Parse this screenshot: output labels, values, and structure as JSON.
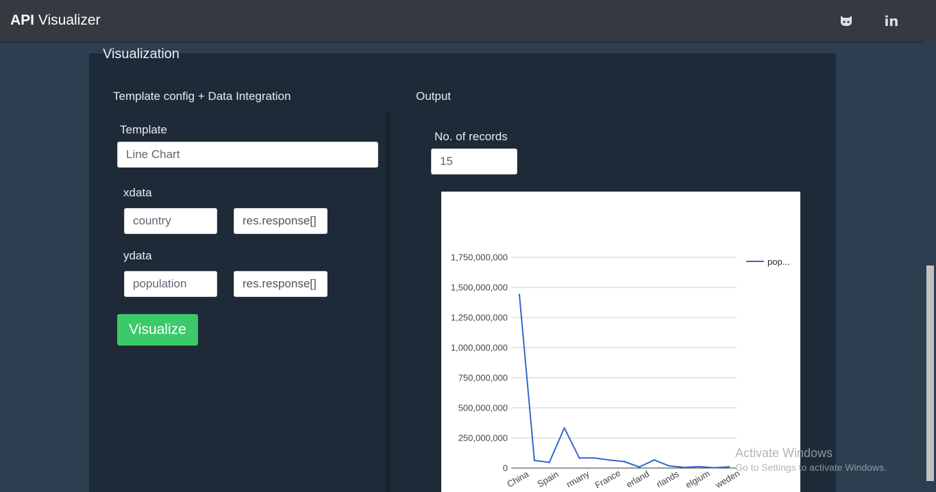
{
  "navbar": {
    "brand_bold": "API",
    "brand_rest": " Visualizer",
    "github_icon": "github-icon",
    "linkedin_icon": "linkedin-icon",
    "linkedin_glyph": "in"
  },
  "section_title": "Visualization",
  "left_panel": {
    "title": "Template config + Data Integration",
    "template_label": "Template",
    "template_value": "Line Chart",
    "xdata_label": "xdata",
    "xdata_field": "country",
    "xdata_path": "res.response[]",
    "ydata_label": "ydata",
    "ydata_field": "population",
    "ydata_path": "res.response[]",
    "visualize_button": "Visualize"
  },
  "right_panel": {
    "title": "Output",
    "records_label": "No. of records",
    "records_value": "15"
  },
  "chart_data": {
    "type": "line",
    "title": "",
    "xlabel": "",
    "ylabel": "",
    "ylim": [
      0,
      1750000000
    ],
    "y_ticks": [
      0,
      250000000,
      500000000,
      750000000,
      1000000000,
      1250000000,
      1500000000,
      1750000000
    ],
    "y_tick_labels": [
      "0",
      "250,000,000",
      "500,000,000",
      "750,000,000",
      "1,000,000,000",
      "1,250,000,000",
      "1,500,000,000",
      "1,750,000,000"
    ],
    "x_tick_labels": [
      "China",
      "Spain",
      "rmany",
      "France",
      "erland",
      "rlands",
      "elgium",
      "weden"
    ],
    "x_tick_indices": [
      0,
      2,
      4,
      6,
      8,
      10,
      12,
      14
    ],
    "grid": true,
    "legend_position": "top-right",
    "series": [
      {
        "name": "pop...",
        "color": "#3366cc",
        "values": [
          1440000000,
          63000000,
          47000000,
          333000000,
          84000000,
          84000000,
          67000000,
          54000000,
          8600000,
          67000000,
          17500000,
          5500000,
          11600000,
          3000000,
          10400000
        ]
      }
    ]
  },
  "watermark": {
    "title": "Activate Windows",
    "subtitle": "Go to Settings to activate Windows."
  }
}
